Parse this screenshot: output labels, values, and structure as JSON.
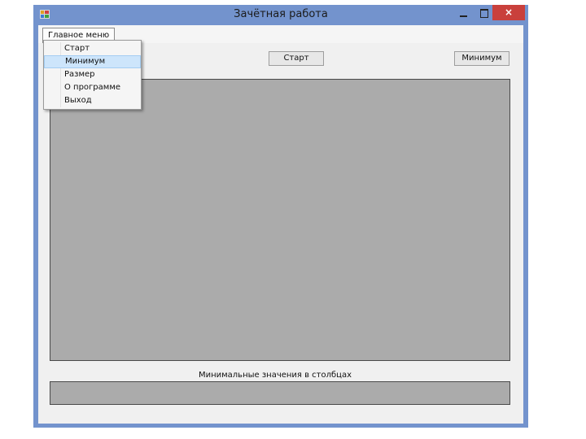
{
  "window": {
    "title": "Зачётная работа",
    "close_glyph": "×",
    "accent_color": "#7393cd",
    "close_color": "#c9403c"
  },
  "menu": {
    "main_label": "Главное меню",
    "items": [
      {
        "label": "Старт",
        "highlighted": false
      },
      {
        "label": "Минимум",
        "highlighted": true
      },
      {
        "label": "Размер",
        "highlighted": false
      },
      {
        "label": "О программе",
        "highlighted": false
      },
      {
        "label": "Выход",
        "highlighted": false
      }
    ]
  },
  "toolbar": {
    "start_label": "Старт",
    "minimum_label": "Минимум"
  },
  "main_grid": {
    "empty": true,
    "background": "#ababab"
  },
  "min_section": {
    "label": "Минимальные значения в столбцах"
  }
}
